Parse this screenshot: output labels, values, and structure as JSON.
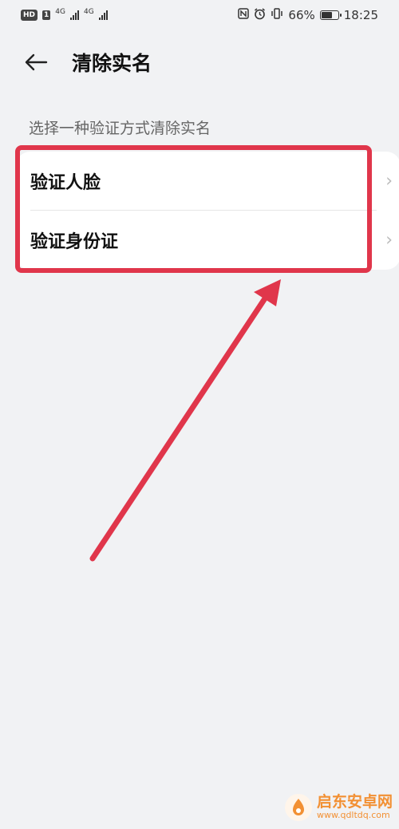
{
  "status_bar": {
    "hd": "HD",
    "sim": "1",
    "net1": "4G",
    "net2": "4G",
    "battery_percent": "66%",
    "battery_level": 0.66,
    "time": "18:25",
    "icons": [
      "nfc-icon",
      "alarm-icon",
      "vibrate-icon",
      "battery-icon"
    ]
  },
  "header": {
    "title": "清除实名",
    "back_icon": "back-arrow-icon"
  },
  "section": {
    "label": "选择一种验证方式清除实名"
  },
  "options": [
    {
      "label": "验证人脸",
      "icon": "chevron-right-icon"
    },
    {
      "label": "验证身份证",
      "icon": "chevron-right-icon"
    }
  ],
  "annotation": {
    "color": "#e0364b"
  },
  "watermark": {
    "name": "启东安卓网",
    "url": "www.qdltdq.com",
    "color": "#f29033"
  }
}
